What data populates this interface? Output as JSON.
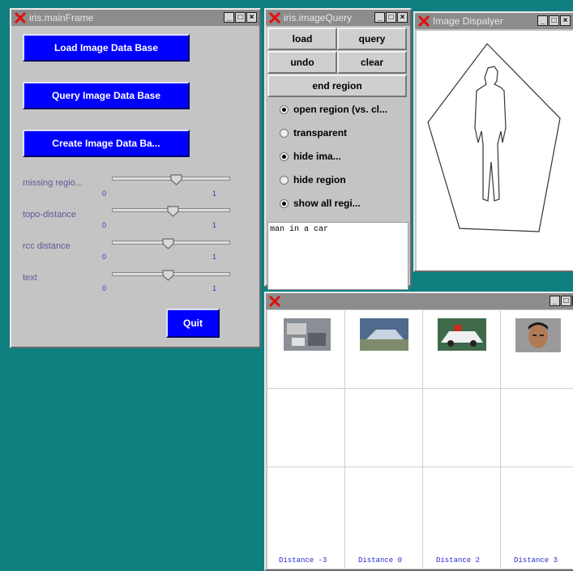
{
  "main_frame": {
    "title": "iris.mainFrame",
    "buttons": {
      "load": "Load Image Data Base",
      "query": "Query Image Data Base",
      "create": "Create Image Data Ba..."
    },
    "sliders": [
      {
        "label": "missing regio...",
        "min": "0",
        "max": "1",
        "value": 0.55
      },
      {
        "label": "topo-distance",
        "min": "0",
        "max": "1",
        "value": 0.52
      },
      {
        "label": "rcc distance",
        "min": "0",
        "max": "1",
        "value": 0.47
      },
      {
        "label": "text",
        "min": "0",
        "max": "1",
        "value": 0.47
      }
    ],
    "quit_label": "Quit"
  },
  "query_window": {
    "title": "iris.imageQuery",
    "buttons": {
      "load": "load",
      "query": "query",
      "undo": "undo",
      "clear": "clear",
      "end_region": "end region"
    },
    "options": [
      {
        "label": "open region (vs. cl...",
        "checked": true
      },
      {
        "label": "transparent",
        "checked": false
      },
      {
        "label": "hide ima...",
        "checked": true
      },
      {
        "label": "hide region",
        "checked": false
      },
      {
        "label": "show all regi...",
        "checked": true
      }
    ],
    "text_value": "man in a car"
  },
  "displayer": {
    "title": "Image Dispalyer"
  },
  "results": {
    "distances": [
      "Distance -3",
      "Distance 0",
      "Distance 2",
      "Distance 3"
    ]
  },
  "colors": {
    "desktop": "#0f7f80",
    "accent_button": "#0000ff"
  }
}
